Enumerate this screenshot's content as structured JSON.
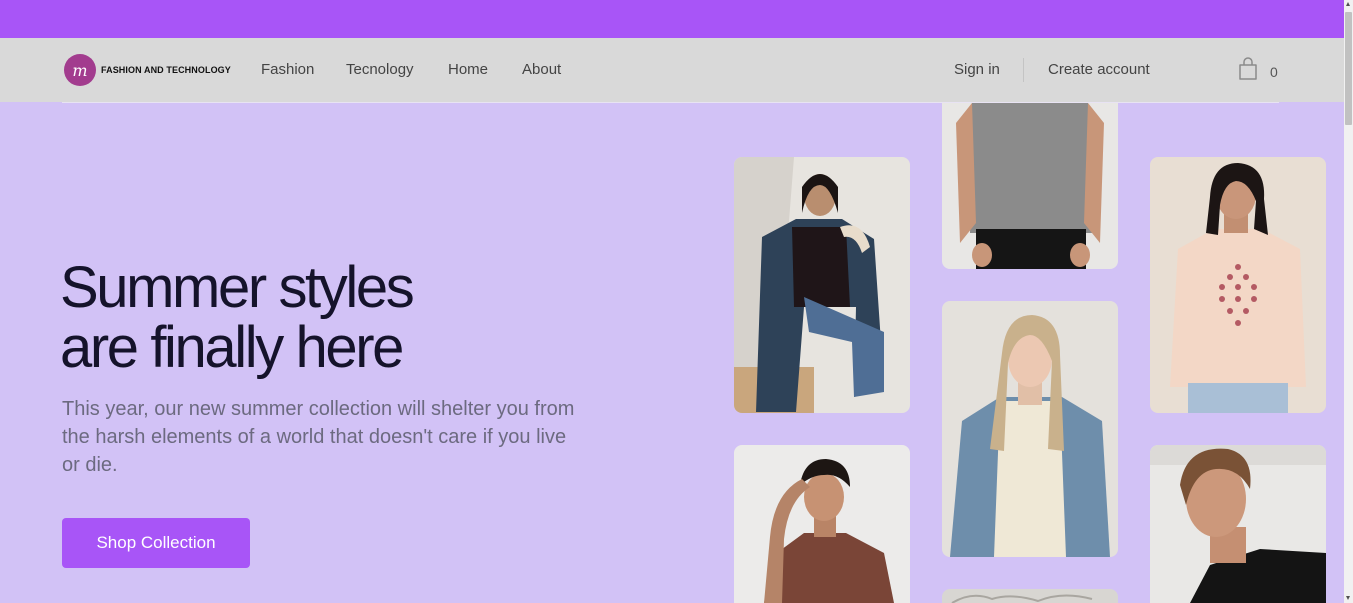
{
  "brand": {
    "name": "FASHION AND TECHNOLOGY",
    "mark": "m",
    "color": "#a23c8e"
  },
  "nav": {
    "links": [
      "Fashion",
      "Tecnology",
      "Home",
      "About"
    ],
    "sign_in": "Sign in",
    "create_account": "Create account",
    "cart_count": "0"
  },
  "hero": {
    "title_line1": "Summer styles",
    "title_line2": "are finally here",
    "description": "This year, our new summer collection will shelter you from the harsh elements of a world that doesn't care if you live or die.",
    "cta": "Shop Collection"
  },
  "colors": {
    "accent": "#a855f7",
    "background": "#d2c2f6",
    "nav_background": "#d9d9d9"
  },
  "gallery": [
    "woman-denim-jacket-photo",
    "man-gray-tshirt-photo",
    "woman-peach-graphic-tee-photo",
    "woman-jean-jacket-photo",
    "man-brown-tshirt-photo",
    "man-black-tshirt-photo",
    "partial-photo"
  ]
}
